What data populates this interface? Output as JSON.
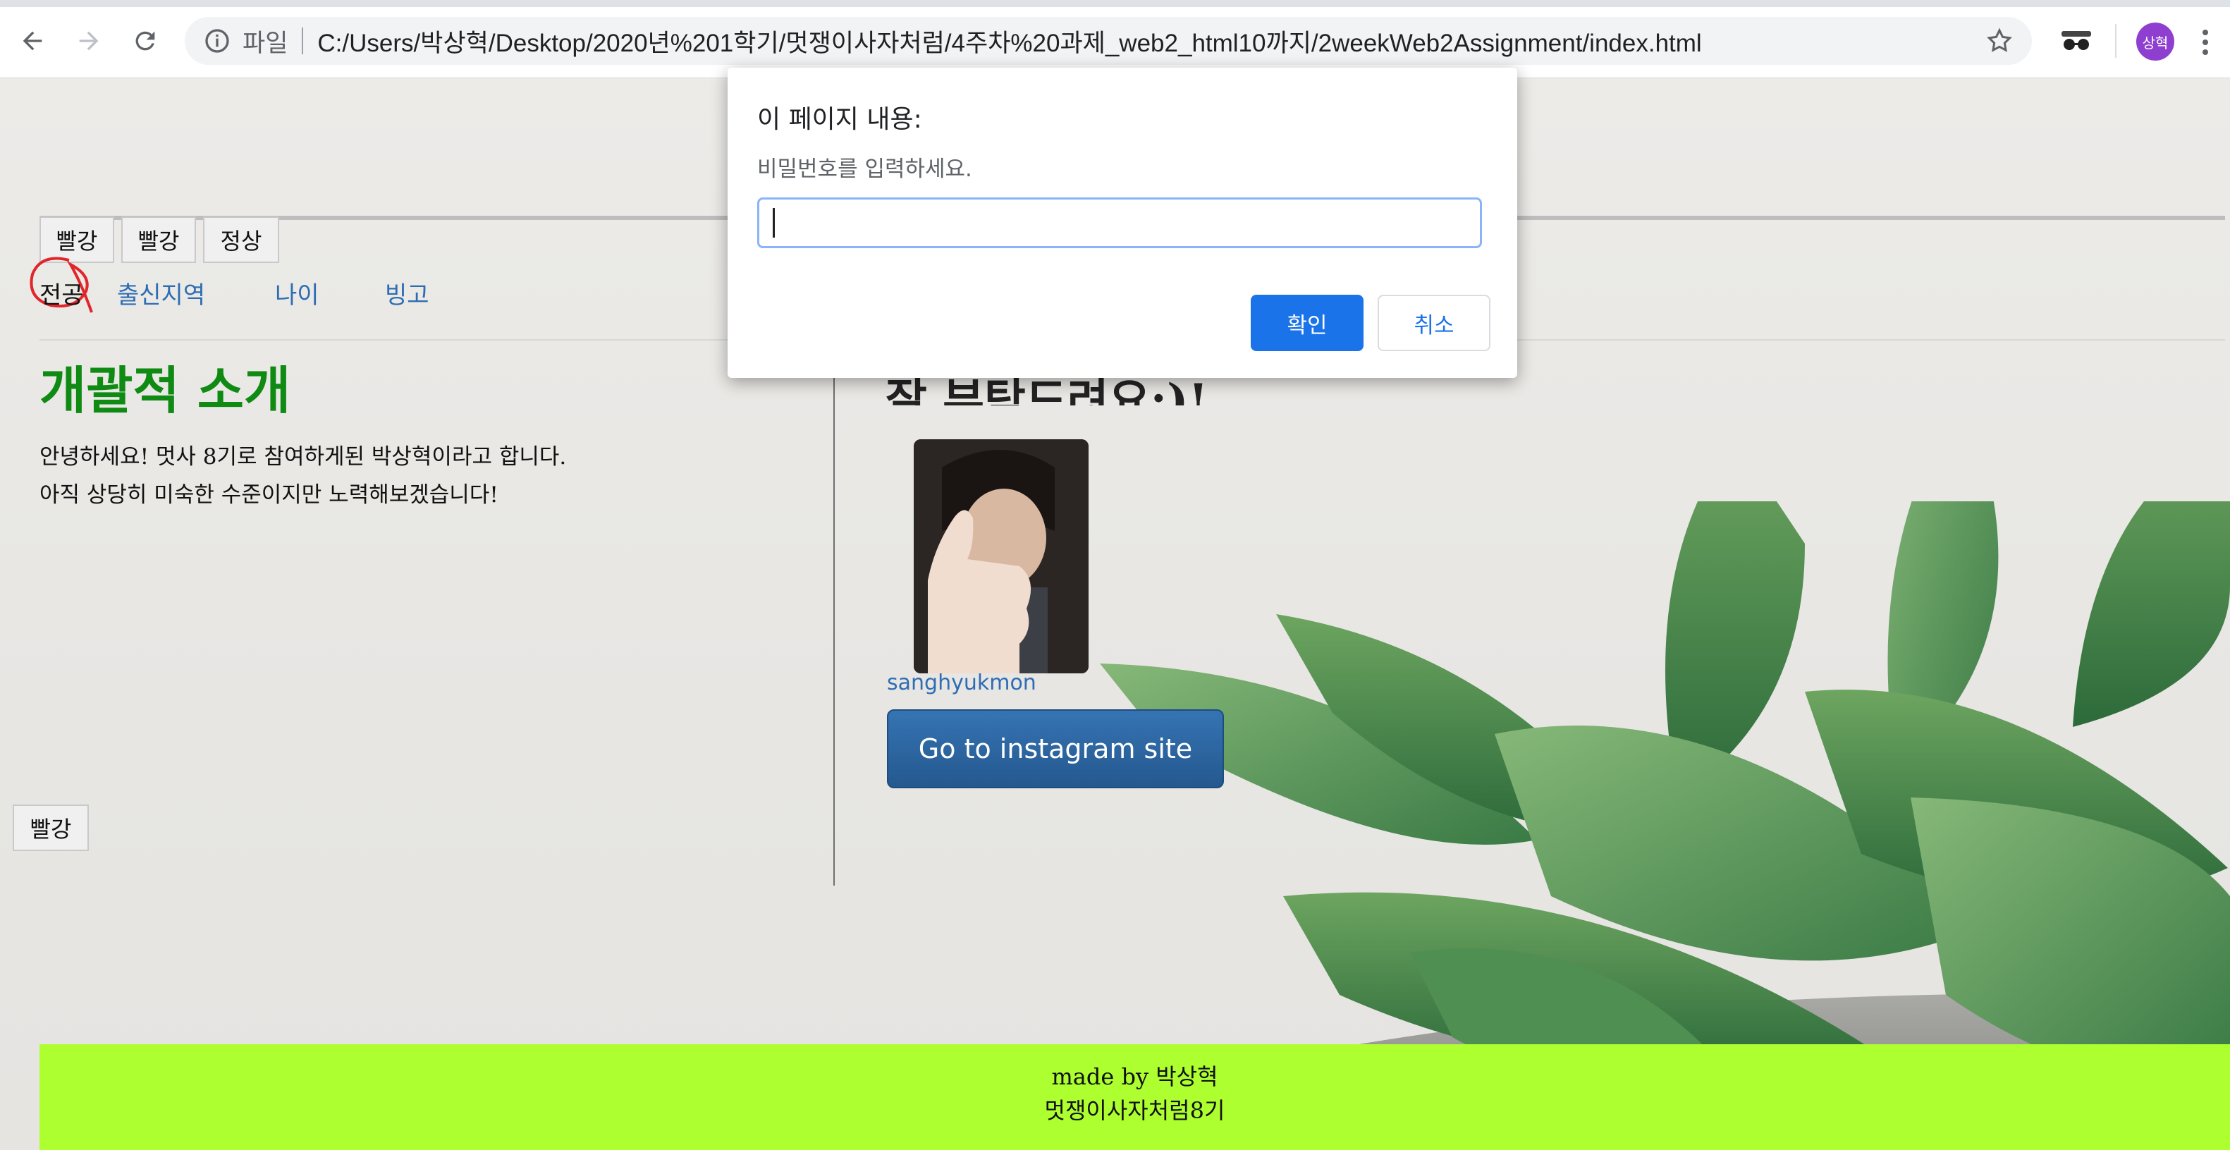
{
  "browser": {
    "scheme_label": "파일",
    "url": "C:/Users/박상혁/Desktop/2020년%201학기/멋쟁이사자처럼/4주차%20과제_web2_html10까지/2weekWeb2Assignment/index.html",
    "profile_name": "상혁"
  },
  "page": {
    "color_buttons": [
      "빨강",
      "빨강",
      "정상"
    ],
    "nav": [
      "전공",
      "출신지역",
      "나이",
      "빙고"
    ],
    "bottom_button": "빨강",
    "intro": {
      "title": "개괄적 소개",
      "lines": [
        "안녕하세요! 멋사 8기로 참여하게된 박상혁이라고 합니다.",
        "아직 상당히 미숙한 수준이지만 노력해보겠습니다!"
      ]
    },
    "right": {
      "heading_partial": "잘 부탁드려요:)!",
      "instagram_handle": "sanghyukmon",
      "instagram_button": "Go to instagram site"
    },
    "footer": {
      "line1": "made by 박상혁",
      "line2": "멋쟁이사자처럼8기"
    }
  },
  "dialog": {
    "title": "이 페이지 내용:",
    "message": "비밀번호를 입력하세요.",
    "input_value": "",
    "ok_label": "확인",
    "cancel_label": "취소"
  },
  "colors": {
    "accent_blue": "#1a73e8",
    "title_green": "#0f8a12",
    "footer_bg": "#adff2f",
    "link_blue": "#2f6db3",
    "avatar_purple": "#8e3fd0"
  }
}
